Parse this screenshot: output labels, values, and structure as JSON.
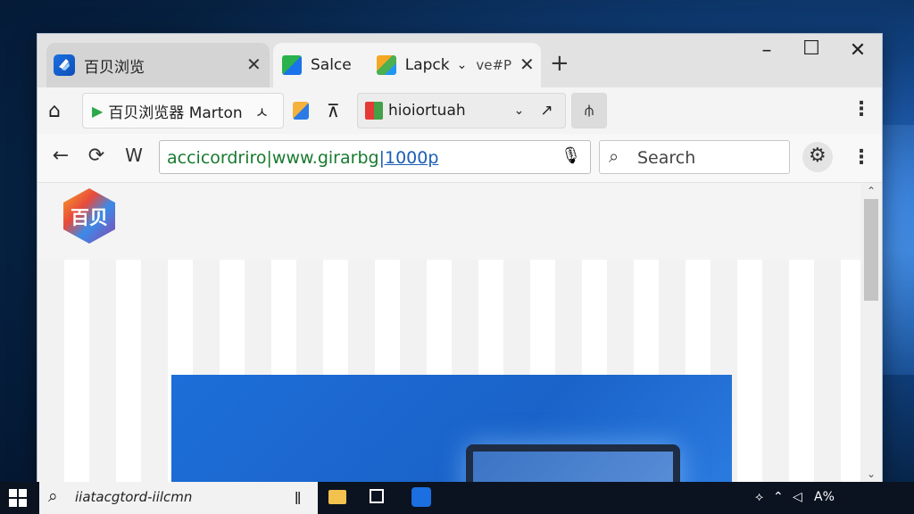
{
  "browser": {
    "tabs": [
      {
        "label": "百贝浏览",
        "icon": "browser-logo-icon",
        "active": false
      },
      {
        "label": "Salce",
        "icon": "green-square-icon",
        "active": true
      },
      {
        "label": "Lapck",
        "icon": "cube-icon",
        "active": true
      }
    ],
    "tab2_extra": "ve#P",
    "bookmarks": [
      {
        "label": "百贝浏览器 Marton",
        "icon": "play-icon"
      },
      {
        "label": "hioiortuah",
        "icon": "red-bookmark-icon"
      }
    ],
    "address": {
      "prefix": "accicordriro|www.girarbg",
      "link": "|1000p"
    },
    "search_placeholder": "Search"
  },
  "page": {
    "logo_text": "百贝"
  },
  "taskbar": {
    "search_text": "iiatacgtord-iilcmn",
    "tray_text": "A%"
  },
  "colors": {
    "accent_blue": "#1d6ed8",
    "address_green": "#177a2e",
    "link_blue": "#1a5fb4",
    "taskbar": "#0b1320"
  }
}
